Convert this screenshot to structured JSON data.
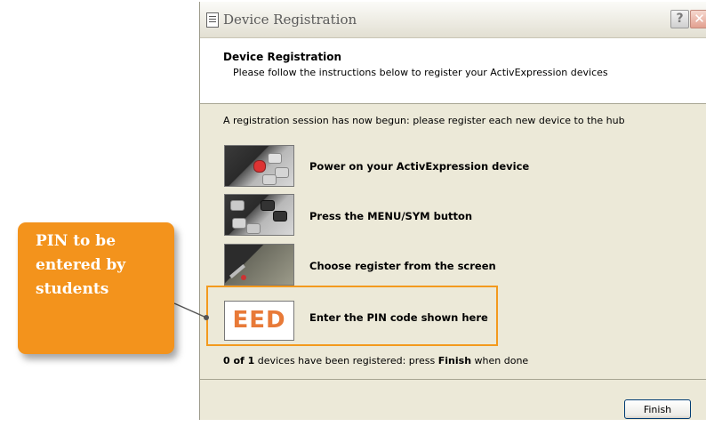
{
  "window": {
    "title": "Device Registration",
    "help_glyph": "?",
    "close_glyph": "✕"
  },
  "header": {
    "title": "Device Registration",
    "subtitle": "Please follow the instructions below to register your ActivExpression devices"
  },
  "intro": "A registration session has now begun: please register each new device to the hub",
  "steps": [
    {
      "label": "Power on your ActivExpression device",
      "icon": "power-button-photo"
    },
    {
      "label": "Press the MENU/SYM button",
      "icon": "menu-sym-button-photo"
    },
    {
      "label": "Choose register from the screen",
      "icon": "device-screen-photo"
    },
    {
      "label": "Enter the PIN code shown here",
      "icon": "pin-code"
    }
  ],
  "pin": "EED",
  "status": {
    "registered": "0 of 1",
    "middle": " devices have been registered: press ",
    "finish_word": "Finish",
    "end": " when done"
  },
  "finish_button": "Finish",
  "callout": {
    "text": "PIN to be entered by students",
    "color": "#f3931c"
  },
  "colors": {
    "pin": "#e87a38",
    "highlight": "#f39a1e",
    "dialog_bg": "#ece9d8"
  }
}
